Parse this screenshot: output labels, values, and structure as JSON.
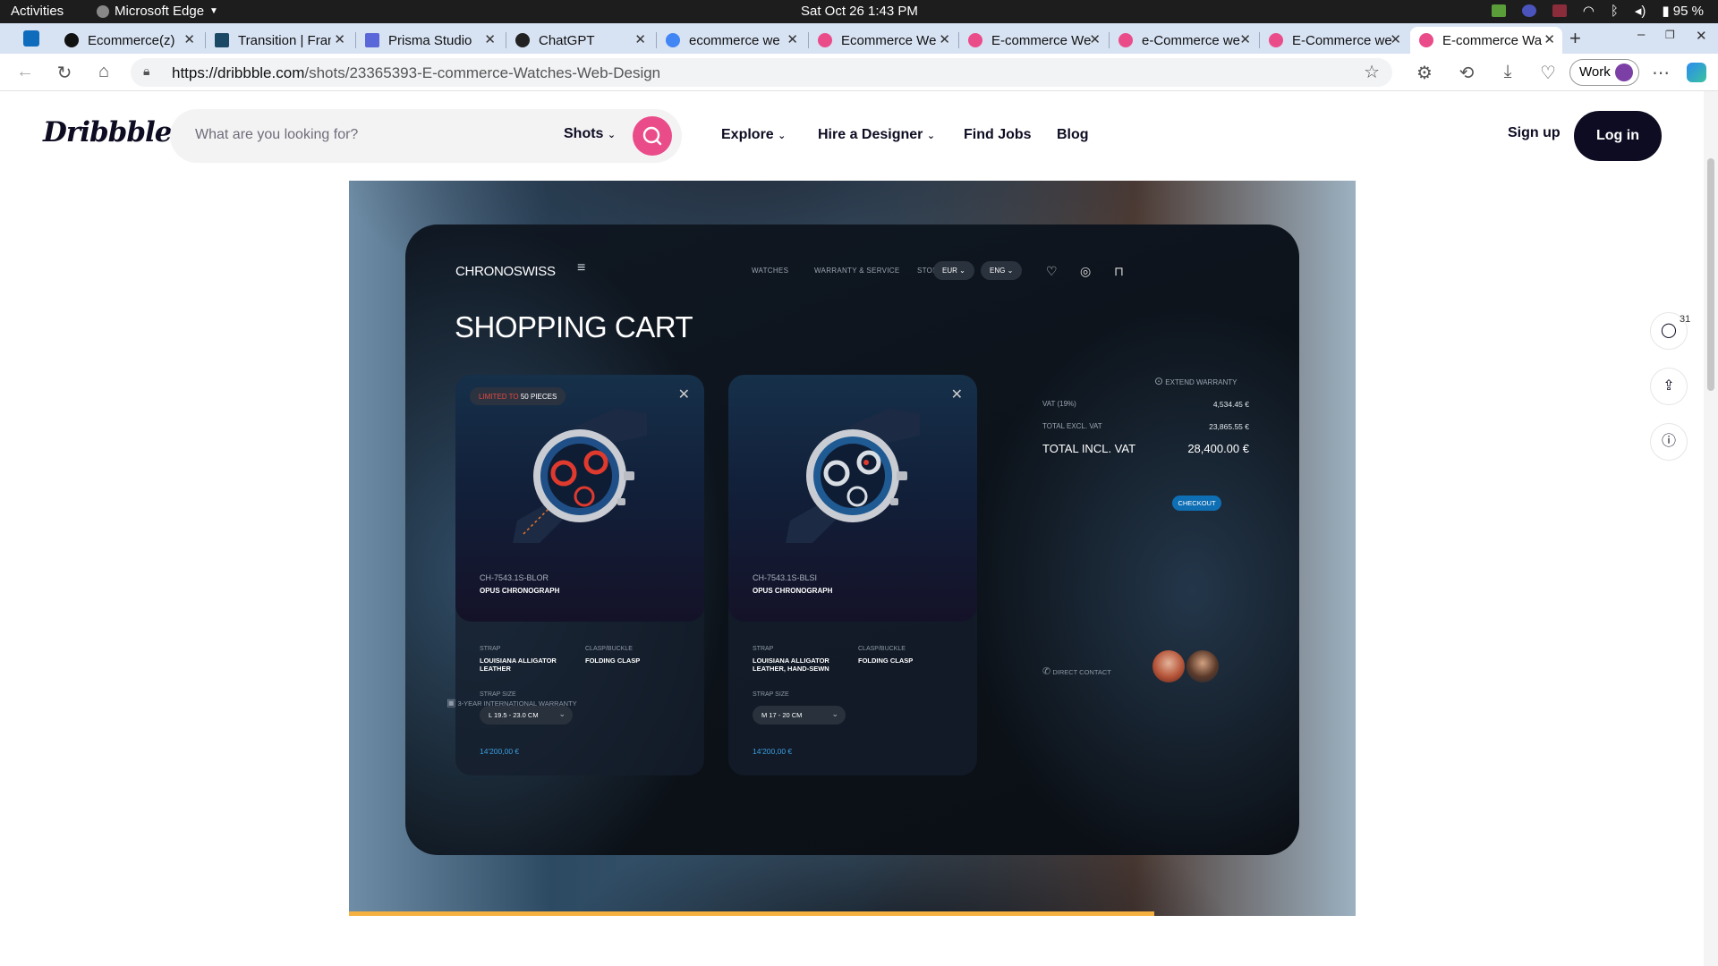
{
  "os": {
    "activities": "Activities",
    "app_name": "Microsoft Edge",
    "clock": "Sat Oct 26  1:43 PM",
    "battery": "95 %"
  },
  "tabs": [
    {
      "title": "Ecommerce(z)",
      "color": "#111111"
    },
    {
      "title": "Transition | Fran",
      "color": "#1b4965"
    },
    {
      "title": "Prisma Studio",
      "color": "#5a67d8"
    },
    {
      "title": "ChatGPT",
      "color": "#222222"
    },
    {
      "title": "ecommerce we",
      "color": "#4285f4"
    },
    {
      "title": "Ecommerce We",
      "color": "#ea4c89"
    },
    {
      "title": "E-commerce We",
      "color": "#ea4c89"
    },
    {
      "title": "e-Commerce we",
      "color": "#ea4c89"
    },
    {
      "title": "E-Commerce we",
      "color": "#ea4c89"
    },
    {
      "title": "E-commerce Wa",
      "color": "#ea4c89"
    }
  ],
  "browser": {
    "url_domain": "https://dribbble.com",
    "url_path": "/shots/23365393-E-commerce-Watches-Web-Design",
    "profile": "Work"
  },
  "dribbble": {
    "logo": "Dribbble",
    "search_placeholder": "What are you looking for?",
    "search_scope": "Shots",
    "nav": [
      "Explore",
      "Hire a Designer",
      "Find Jobs",
      "Blog"
    ],
    "signup": "Sign up",
    "login": "Log in",
    "comment_count": "31"
  },
  "shot": {
    "brand": "CHRONOSWISS",
    "links": [
      "WATCHES",
      "WARRANTY & SERVICE",
      "STORES"
    ],
    "currency": "EUR",
    "language": "ENG",
    "title": "SHOPPING CART",
    "extend_warranty": "EXTEND WARRANTY",
    "products": [
      {
        "badge_red": "LIMITED TO",
        "badge_white": "50 PIECES",
        "sku": "CH-7543.1S-BLOR",
        "model": "OPUS CHRONOGRAPH",
        "strap_label": "STRAP",
        "strap": "LOUISIANA ALLIGATOR LEATHER",
        "clasp_label": "CLASP/BUCKLE",
        "clasp": "FOLDING CLASP",
        "size_label": "STRAP SIZE",
        "size": "L 19.5 - 23.0 CM",
        "price": "14'200,00 €"
      },
      {
        "sku": "CH-7543.1S-BLSI",
        "model": "OPUS CHRONOGRAPH",
        "strap_label": "STRAP",
        "strap": "LOUISIANA ALLIGATOR LEATHER, HAND-SEWN",
        "clasp_label": "CLASP/BUCKLE",
        "clasp": "FOLDING CLASP",
        "size_label": "STRAP SIZE",
        "size": "M 17 - 20 CM",
        "price": "14'200,00 €"
      }
    ],
    "summary": {
      "vat_label": "VAT (19%)",
      "vat": "4,534.45 €",
      "excl_label": "TOTAL EXCL. VAT",
      "excl": "23,865.55 €",
      "incl_label": "TOTAL INCL. VAT",
      "incl": "28,400.00 €"
    },
    "checkout": "CHECKOUT",
    "direct_contact": "DIRECT CONTACT",
    "warranty_note": "3-YEAR INTERNATIONAL WARRANTY",
    "progress": 0.8
  }
}
